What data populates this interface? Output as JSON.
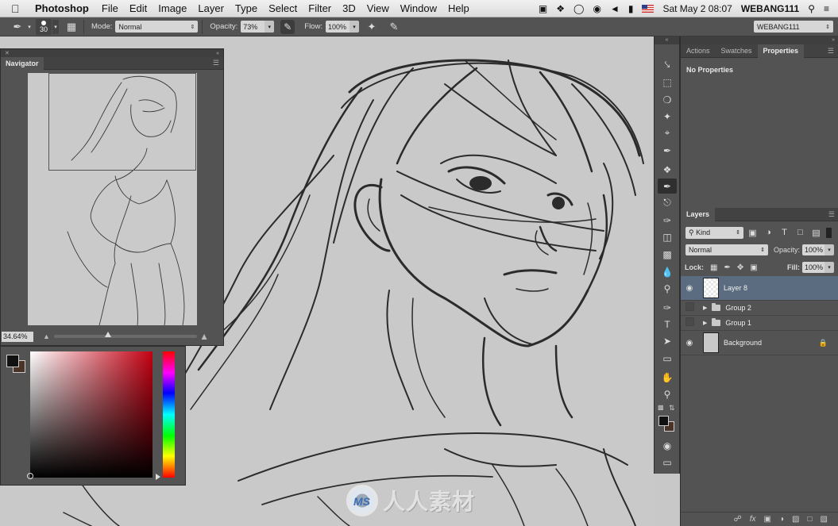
{
  "menubar": {
    "app_name": "Photoshop",
    "menus": [
      "File",
      "Edit",
      "Image",
      "Layer",
      "Type",
      "Select",
      "Filter",
      "3D",
      "View",
      "Window",
      "Help"
    ],
    "datetime": "Sat May 2  08:07",
    "user": "WEBANG111",
    "status_icons": [
      "camera-icon",
      "dropbox-icon",
      "sync-icon",
      "wifi-icon",
      "volume-icon",
      "battery-icon",
      "us-flag-icon",
      "search-icon",
      "list-icon"
    ]
  },
  "options": {
    "brush_size": "30",
    "mode_label": "Mode:",
    "mode_value": "Normal",
    "opacity_label": "Opacity:",
    "opacity_value": "73%",
    "flow_label": "Flow:",
    "flow_value": "100%",
    "workspace": "WEBANG111"
  },
  "navigator": {
    "title": "Navigator",
    "zoom": "34.64%"
  },
  "color": {
    "foreground": "#111111",
    "background": "#4a3327",
    "base_hue": "#c40012"
  },
  "tools": [
    "move-tool-icon",
    "marquee-tool-icon",
    "lasso-tool-icon",
    "magic-wand-tool-icon",
    "crop-tool-icon",
    "eyedropper-tool-icon",
    "healing-brush-tool-icon",
    "brush-tool-icon",
    "clone-stamp-tool-icon",
    "history-brush-tool-icon",
    "eraser-tool-icon",
    "gradient-tool-icon",
    "blur-tool-icon",
    "dodge-tool-icon",
    "pen-tool-icon",
    "type-tool-icon",
    "path-selection-tool-icon",
    "rectangle-tool-icon",
    "hand-tool-icon",
    "zoom-tool-icon"
  ],
  "properties": {
    "tabs": [
      "Actions",
      "Swatches",
      "Properties"
    ],
    "active_tab": "Properties",
    "message": "No Properties"
  },
  "layers": {
    "title": "Layers",
    "kind_label": "Kind",
    "blend_mode": "Normal",
    "opacity_label": "Opacity:",
    "opacity_value": "100%",
    "lock_label": "Lock:",
    "fill_label": "Fill:",
    "fill_value": "100%",
    "items": [
      {
        "name": "Layer 8",
        "visible": true,
        "selected": true,
        "type": "layer"
      },
      {
        "name": "Group 2",
        "visible": false,
        "selected": false,
        "type": "group"
      },
      {
        "name": "Group 1",
        "visible": false,
        "selected": false,
        "type": "group"
      },
      {
        "name": "Background",
        "visible": true,
        "selected": false,
        "type": "background",
        "locked": true
      }
    ]
  },
  "watermark": "人人素材"
}
